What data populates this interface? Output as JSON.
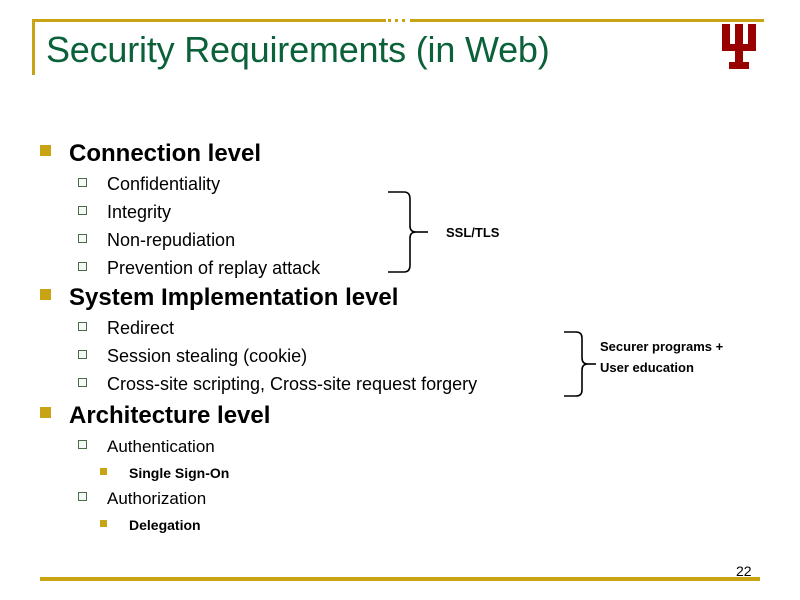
{
  "slide": {
    "title": "Security Requirements (in Web)",
    "page_number": "22",
    "accent_gold": "#C8A415",
    "title_green": "#0B6139",
    "logo_crimson": "#990000",
    "logo_name": "indiana-university-trident-logo"
  },
  "sections": [
    {
      "heading": "Connection level",
      "items": [
        {
          "label": "Confidentiality"
        },
        {
          "label": "Integrity"
        },
        {
          "label": "Non-repudiation"
        },
        {
          "label": "Prevention of replay attack"
        }
      ],
      "annotation": "SSL/TLS"
    },
    {
      "heading": "System Implementation level",
      "items": [
        {
          "label": "Redirect"
        },
        {
          "label": "Session stealing (cookie)"
        },
        {
          "label": "Cross-site scripting, Cross-site request forgery"
        }
      ],
      "annotation_line1": "Securer programs +",
      "annotation_line2": "User education"
    },
    {
      "heading": "Architecture level",
      "items": [
        {
          "label": "Authentication",
          "children": [
            {
              "label": "Single Sign-On"
            }
          ]
        },
        {
          "label": "Authorization",
          "children": [
            {
              "label": "Delegation"
            }
          ]
        }
      ]
    }
  ]
}
